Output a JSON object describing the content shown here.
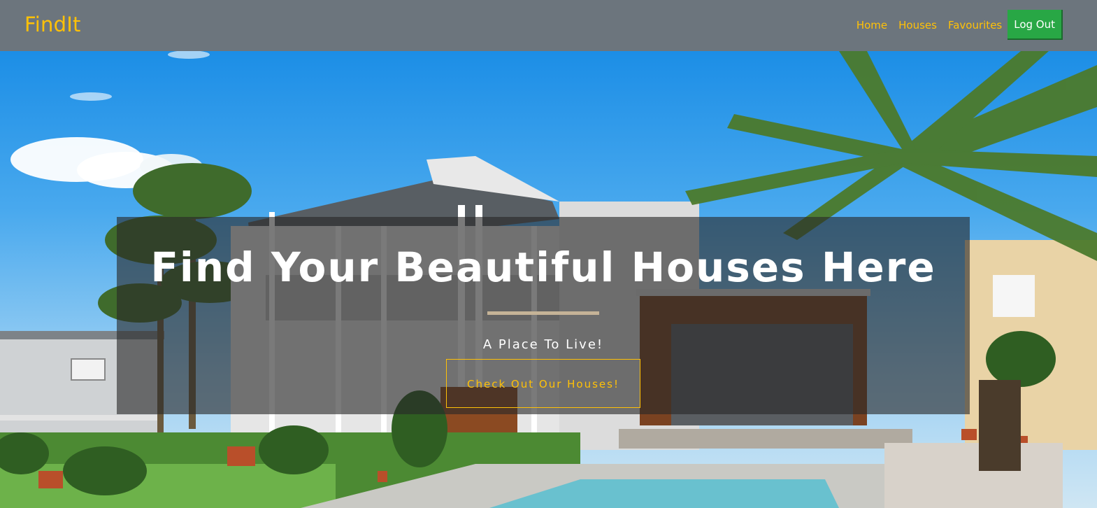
{
  "navbar": {
    "brand": "FindIt",
    "links": [
      {
        "label": "Home"
      },
      {
        "label": "Houses"
      },
      {
        "label": "Favourites"
      }
    ],
    "logout_label": "Log Out"
  },
  "hero": {
    "title": "Find Your Beautiful Houses Here",
    "tagline": "A Place To Live!",
    "cta_label": "Check Out Our Houses!"
  },
  "colors": {
    "navbar_bg": "#6c757d",
    "accent_yellow": "#ffc107",
    "logout_green": "#28a745",
    "divider": "#c5b397"
  }
}
